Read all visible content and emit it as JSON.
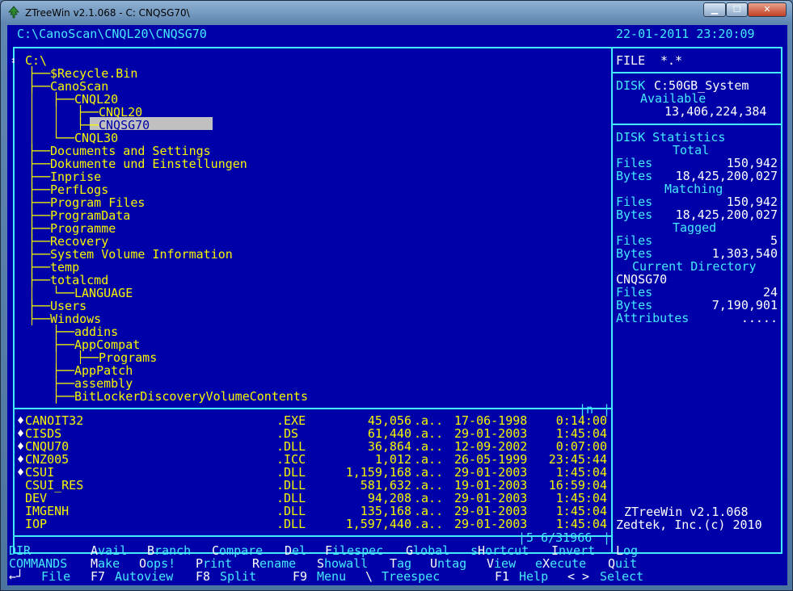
{
  "window": {
    "title": "ZTreeWin v2.1.068 - C: CNQSG70\\",
    "min_label": "▁",
    "max_label": "☐",
    "close_label": "✕"
  },
  "header": {
    "path": "C:\\CanoScan\\CNQL20\\CNQSG70",
    "datetime": "22-01-2011 23:20:09"
  },
  "tree": {
    "root": "C:\\",
    "items": [
      {
        "plus": "+",
        "indent": 0,
        "last": false,
        "name": "$Recycle.Bin"
      },
      {
        "plus": "",
        "indent": 0,
        "last": false,
        "name": "CanoScan"
      },
      {
        "plus": "",
        "indent": 1,
        "last": false,
        "name": "CNQL20"
      },
      {
        "plus": "",
        "indent": 2,
        "last": false,
        "name": "CNQL20"
      },
      {
        "plus": "",
        "indent": 2,
        "last": true,
        "name": "CNQSG70",
        "selected": true
      },
      {
        "plus": "+",
        "indent": 1,
        "last": true,
        "name": "CNQL30"
      },
      {
        "plus": "+",
        "indent": 0,
        "last": false,
        "name": "Documents and Settings"
      },
      {
        "plus": "+",
        "indent": 0,
        "last": false,
        "name": "Dokumente und Einstellungen"
      },
      {
        "plus": "+",
        "indent": 0,
        "last": false,
        "name": "Inprise"
      },
      {
        "plus": "+",
        "indent": 0,
        "last": false,
        "name": "PerfLogs"
      },
      {
        "plus": "+",
        "indent": 0,
        "last": false,
        "name": "Program Files"
      },
      {
        "plus": "+",
        "indent": 0,
        "last": false,
        "name": "ProgramData"
      },
      {
        "plus": "+",
        "indent": 0,
        "last": false,
        "name": "Programme"
      },
      {
        "plus": "+",
        "indent": 0,
        "last": false,
        "name": "Recovery"
      },
      {
        "plus": "+",
        "indent": 0,
        "last": false,
        "name": "System Volume Information"
      },
      {
        "plus": "+",
        "indent": 0,
        "last": false,
        "name": "temp"
      },
      {
        "plus": "",
        "indent": 0,
        "last": false,
        "name": "totalcmd"
      },
      {
        "plus": "+",
        "indent": 1,
        "last": true,
        "name": "LANGUAGE"
      },
      {
        "plus": "+",
        "indent": 0,
        "last": false,
        "name": "Users"
      },
      {
        "plus": "",
        "indent": 0,
        "last": true,
        "name": "Windows"
      },
      {
        "plus": "",
        "indent": 1,
        "last": false,
        "name": "addins"
      },
      {
        "plus": "",
        "indent": 1,
        "last": false,
        "name": "AppCompat"
      },
      {
        "plus": "+",
        "indent": 2,
        "last": true,
        "name": "Programs"
      },
      {
        "plus": "+",
        "indent": 1,
        "last": false,
        "name": "AppPatch"
      },
      {
        "plus": "+",
        "indent": 1,
        "last": false,
        "name": "assembly"
      },
      {
        "plus": "",
        "indent": 1,
        "last": false,
        "name": "BitLockerDiscoveryVolumeContents"
      }
    ],
    "split_marker": "n"
  },
  "files": [
    {
      "tag": "♦",
      "name": "CANOIT32",
      "ext": ".EXE",
      "size": "45,056",
      "attr": ".a..",
      "date": "17-06-1998",
      "time": "0:14:00"
    },
    {
      "tag": "♦",
      "name": "CISDS",
      "ext": ".DS",
      "size": "61,440",
      "attr": ".a..",
      "date": "29-01-2003",
      "time": "1:45:04"
    },
    {
      "tag": "♦",
      "name": "CNQU70",
      "ext": ".DLL",
      "size": "36,864",
      "attr": ".a..",
      "date": "12-09-2002",
      "time": "0:07:00"
    },
    {
      "tag": "♦",
      "name": "CNZ005",
      "ext": ".ICC",
      "size": "1,012",
      "attr": ".a..",
      "date": "26-05-1999",
      "time": "23:45:44"
    },
    {
      "tag": "♦",
      "name": "CSUI",
      "ext": ".DLL",
      "size": "1,159,168",
      "attr": ".a..",
      "date": "29-01-2003",
      "time": "1:45:04"
    },
    {
      "tag": "",
      "name": "CSUI_RES",
      "ext": ".DLL",
      "size": "581,632",
      "attr": ".a..",
      "date": "19-01-2003",
      "time": "16:59:04"
    },
    {
      "tag": "",
      "name": "DEV",
      "ext": ".DLL",
      "size": "94,208",
      "attr": ".a..",
      "date": "29-01-2003",
      "time": "1:45:04"
    },
    {
      "tag": "",
      "name": "IMGENH",
      "ext": ".DLL",
      "size": "135,168",
      "attr": ".a..",
      "date": "29-01-2003",
      "time": "1:45:04"
    },
    {
      "tag": "",
      "name": "IOP",
      "ext": ".DLL",
      "size": "1,597,440",
      "attr": ".a..",
      "date": "29-01-2003",
      "time": "1:45:04"
    }
  ],
  "file_counter": "5 6/31966",
  "info": {
    "filespec_label": "FILE",
    "filespec_value": "*.*",
    "disk_label": "DISK",
    "disk_name": "C:50GB_System",
    "available_label": "Available",
    "available_value": "13,406,224,384",
    "stats_title": "DISK Statistics",
    "total_label": "Total",
    "total_files": "150,942",
    "total_bytes": "18,425,200,027",
    "matching_label": "Matching",
    "matching_files": "150,942",
    "matching_bytes": "18,425,200,027",
    "tagged_label": "Tagged",
    "tagged_files": "5",
    "tagged_bytes": "1,303,540",
    "curdir_label": "Current Directory",
    "curdir_name": "CNQSG70",
    "curdir_files": "24",
    "curdir_bytes": "7,190,901",
    "files_label": "Files",
    "bytes_label": "Bytes",
    "attributes_label": "Attributes",
    "attributes_value": ".....",
    "product": "ZTreeWin v2.1.068",
    "copyright": "Zedtek, Inc.(c) 2010"
  },
  "menu": {
    "row1_label": "DIR",
    "row1": [
      {
        "hot": "A",
        "rest": "vail"
      },
      {
        "hot": "B",
        "rest": "ranch"
      },
      {
        "hot": "C",
        "rest": "ompare"
      },
      {
        "hot": "D",
        "rest": "el"
      },
      {
        "hot": "F",
        "rest": "ilespec"
      },
      {
        "hot": "G",
        "rest": "lobal"
      },
      {
        "pre": "s",
        "hot": "H",
        "rest": "ortcut"
      },
      {
        "hot": "I",
        "rest": "nvert"
      },
      {
        "hot": "L",
        "rest": "og"
      }
    ],
    "row2_label": "COMMANDS",
    "row2": [
      {
        "hot": "M",
        "rest": "ake"
      },
      {
        "hot": "O",
        "rest": "ops!"
      },
      {
        "hot": "P",
        "rest": "rint"
      },
      {
        "hot": "R",
        "rest": "ename"
      },
      {
        "hot": "S",
        "rest": "howall"
      },
      {
        "hot": "T",
        "rest": "ag"
      },
      {
        "hot": "U",
        "rest": "ntag"
      },
      {
        "hot": "V",
        "rest": "iew"
      },
      {
        "pre": "e",
        "hot": "X",
        "rest": "ecute"
      },
      {
        "hot": "Q",
        "rest": "uit"
      }
    ],
    "row3": [
      {
        "key": "←┘",
        "label": "File"
      },
      {
        "key": "F7",
        "label": "Autoview"
      },
      {
        "key": "F8",
        "label": "Split"
      },
      {
        "key": "F9",
        "label": "Menu"
      },
      {
        "key": "\\",
        "label": "Treespec"
      },
      {
        "key": "F1",
        "label": "Help"
      },
      {
        "key": "< >",
        "label": "Select"
      }
    ]
  }
}
